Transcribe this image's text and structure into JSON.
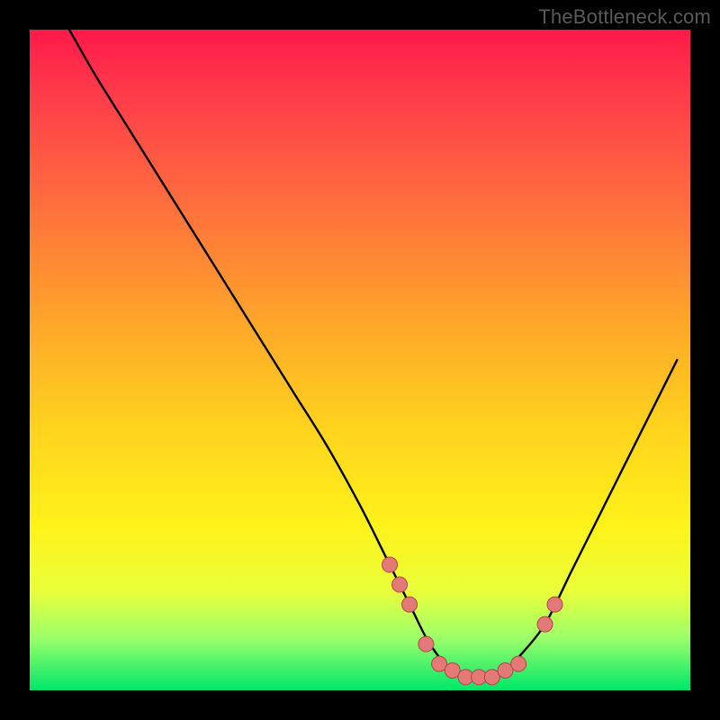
{
  "attribution": "TheBottleneck.com",
  "colors": {
    "page_bg": "#000000",
    "curve": "#000000",
    "marker_fill": "#e47a78",
    "marker_stroke": "#b04744",
    "gradient_stops": [
      "#ff1a4a",
      "#ff3c4a",
      "#ff6a3f",
      "#ffa829",
      "#ffd21e",
      "#fff21a",
      "#e9ff3a",
      "#9dff6a",
      "#00e66a"
    ]
  },
  "chart_data": {
    "type": "line",
    "title": "",
    "xlabel": "",
    "ylabel": "",
    "xlim": [
      0,
      100
    ],
    "ylim": [
      0,
      100
    ],
    "series": [
      {
        "name": "bottleneck-curve",
        "x": [
          6,
          10,
          15,
          20,
          25,
          30,
          35,
          40,
          45,
          50,
          54,
          56,
          58,
          60,
          62,
          64,
          66,
          68,
          70,
          72,
          74,
          78,
          82,
          86,
          90,
          94,
          98
        ],
        "y": [
          100,
          93,
          85,
          77,
          69,
          61,
          53,
          45,
          37,
          28,
          20,
          16,
          12,
          8,
          5,
          3,
          2,
          2,
          2,
          3,
          5,
          10,
          18,
          26,
          34,
          42,
          50
        ]
      }
    ],
    "markers": {
      "name": "highlight-points",
      "x": [
        54.5,
        56,
        57.5,
        60,
        62,
        64,
        66,
        68,
        70,
        72,
        74,
        78,
        79.5
      ],
      "y": [
        19,
        16,
        13,
        7,
        4,
        3,
        2,
        2,
        2,
        3,
        4,
        10,
        13
      ]
    }
  }
}
